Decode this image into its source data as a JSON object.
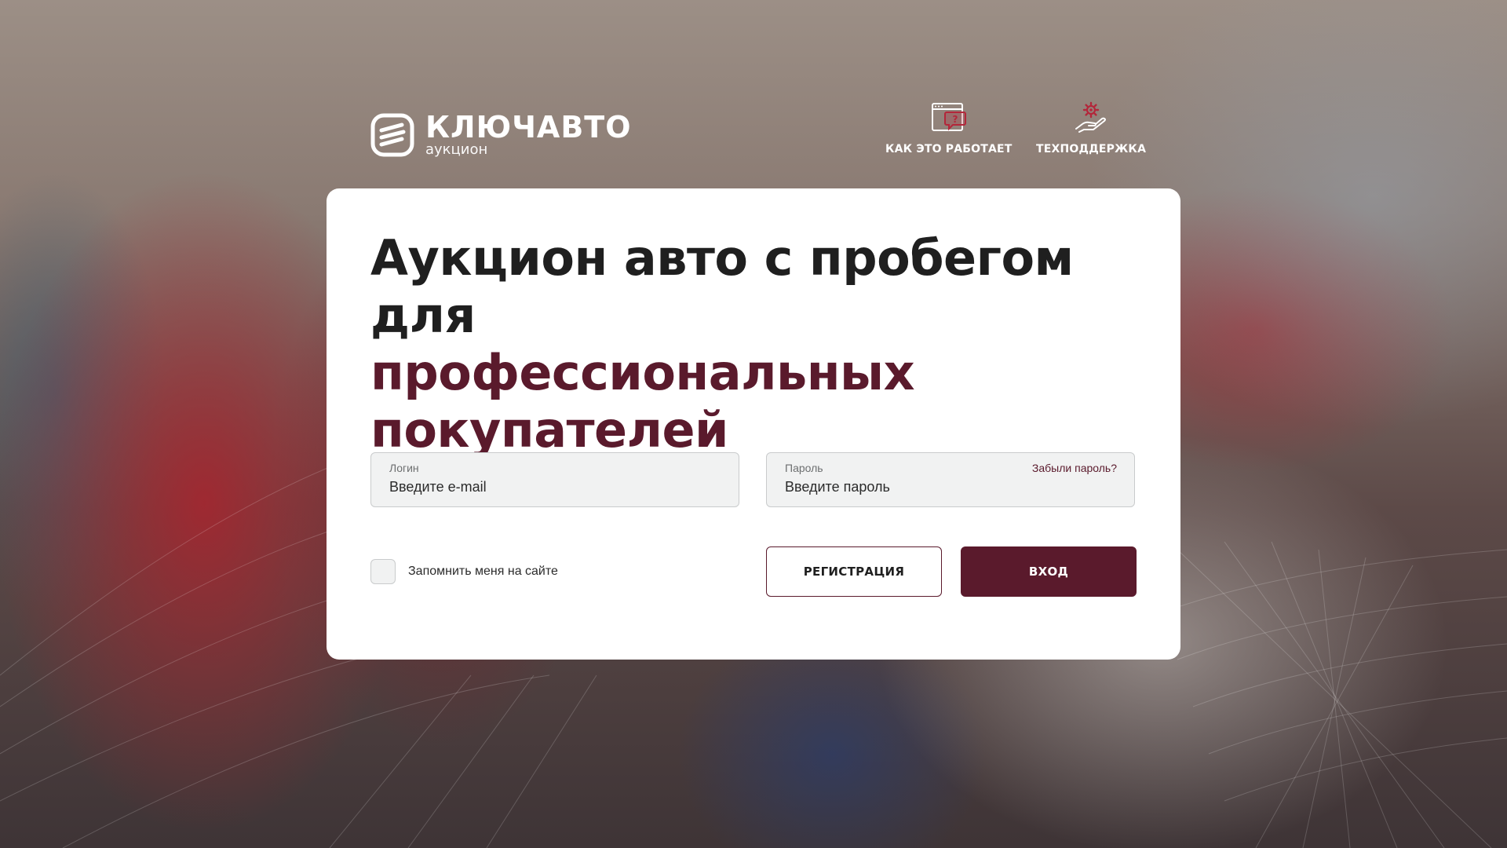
{
  "brand": {
    "name": "КЛЮЧАВТО",
    "subtitle": "аукцион"
  },
  "nav": {
    "how_it_works": {
      "label": "КАК ЭТО РАБОТАЕТ",
      "icon": "browser-question-icon"
    },
    "support": {
      "label": "ТЕХПОДДЕРЖКА",
      "icon": "hand-gear-icon"
    }
  },
  "hero": {
    "line1": "Аукцион авто с пробегом для",
    "line2": "профессиональных",
    "line3": "покупателей"
  },
  "form": {
    "login": {
      "label": "Логин",
      "placeholder": "Введите e-mail"
    },
    "password": {
      "label": "Пароль",
      "placeholder": "Введите пароль",
      "forgot": "Забыли пароль?"
    },
    "remember": {
      "label": "Запомнить меня на сайте",
      "checked": false
    },
    "register_button": "РЕГИСТРАЦИЯ",
    "login_button": "ВХОД"
  },
  "colors": {
    "accent": "#5a1a2c",
    "text_dark": "#1f1f1f",
    "field_bg": "#f1f2f2",
    "icon_red": "#b3263a"
  }
}
